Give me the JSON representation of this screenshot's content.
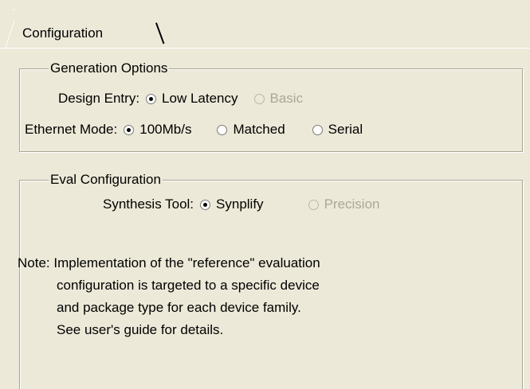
{
  "tab": {
    "label": "Configuration"
  },
  "generation": {
    "title": "Generation Options",
    "design_entry_label": "Design Entry:",
    "design_entry_options": [
      {
        "label": "Low Latency",
        "checked": true,
        "enabled": true
      },
      {
        "label": "Basic",
        "checked": false,
        "enabled": false
      }
    ],
    "ethernet_label": "Ethernet Mode:",
    "ethernet_options": [
      {
        "label": "100Mb/s",
        "checked": true,
        "enabled": true
      },
      {
        "label": "Matched",
        "checked": false,
        "enabled": true
      },
      {
        "label": "Serial",
        "checked": false,
        "enabled": true
      }
    ]
  },
  "eval": {
    "title": "Eval Configuration",
    "synthesis_label": "Synthesis Tool:",
    "synthesis_options": [
      {
        "label": "Synplify",
        "checked": true,
        "enabled": true
      },
      {
        "label": "Precision",
        "checked": false,
        "enabled": false
      }
    ],
    "note": [
      "Note:  Implementation of the \"reference\" evaluation",
      "configuration is targeted to a specific device",
      "and package type for each device family.",
      "See user's guide for details."
    ]
  }
}
